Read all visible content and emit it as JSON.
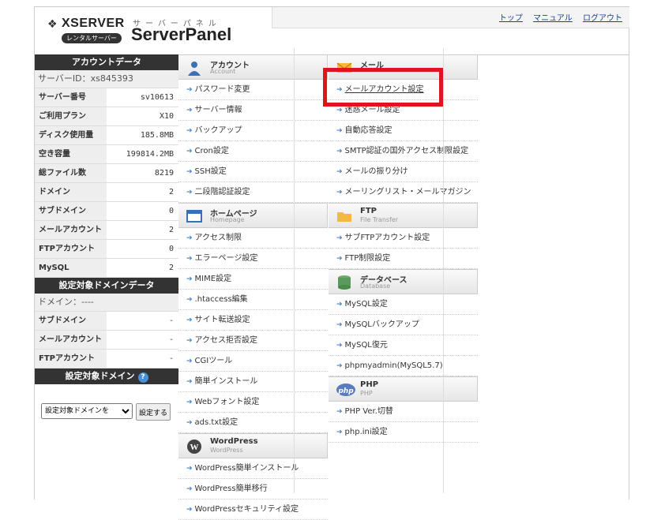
{
  "header": {
    "logo_text": "XSERVER",
    "logo_sub": "レンタルサーバー",
    "panel_kana": "サーバーパネル",
    "panel_title": "ServerPanel",
    "links": [
      "トップ",
      "マニュアル",
      "ログアウト"
    ]
  },
  "account": {
    "title": "アカウントデータ",
    "server_id_label": "サーバーID：",
    "server_id": "xs845393",
    "rows": [
      {
        "k": "サーバー番号",
        "v": "sv10613"
      },
      {
        "k": "ご利用プラン",
        "v": "X10"
      },
      {
        "k": "ディスク使用量",
        "v": "185.8MB"
      },
      {
        "k": "空き容量",
        "v": "199814.2MB"
      },
      {
        "k": "総ファイル数",
        "v": "8219"
      },
      {
        "k": "ドメイン",
        "v": "2"
      },
      {
        "k": "サブドメイン",
        "v": "0"
      },
      {
        "k": "メールアカウント",
        "v": "2"
      },
      {
        "k": "FTPアカウント",
        "v": "0"
      },
      {
        "k": "MySQL",
        "v": "2"
      }
    ]
  },
  "domain_data": {
    "title": "設定対象ドメインデータ",
    "domain_label": "ドメイン：",
    "domain_value": "----",
    "rows": [
      {
        "k": "サブドメイン",
        "v": "-"
      },
      {
        "k": "メールアカウント",
        "v": "-"
      },
      {
        "k": "FTPアカウント",
        "v": "-"
      }
    ]
  },
  "domain_select": {
    "title": "設定対象ドメイン",
    "select_value": "設定対象ドメインを",
    "button": "設定する"
  },
  "col1": {
    "account": {
      "title": "アカウント",
      "sub": "Account",
      "items": [
        "パスワード変更",
        "サーバー情報",
        "バックアップ",
        "Cron設定",
        "SSH設定",
        "二段階認証設定"
      ]
    },
    "homepage": {
      "title": "ホームページ",
      "sub": "Homepage",
      "items": [
        "アクセス制限",
        "エラーページ設定",
        "MIME設定",
        ".htaccess編集",
        "サイト転送設定",
        "アクセス拒否設定",
        "CGIツール",
        "簡単インストール",
        "Webフォント設定",
        "ads.txt設定"
      ]
    },
    "wordpress": {
      "title": "WordPress",
      "sub": "WordPress",
      "items": [
        "WordPress簡単インストール",
        "WordPress簡単移行",
        "WordPressセキュリティ設定"
      ]
    }
  },
  "col2": {
    "mail": {
      "title": "メール",
      "sub": "",
      "items": [
        "メールアカウント設定",
        "迷惑メール設定",
        "自動応答設定",
        "SMTP認証の国外アクセス制限設定",
        "メールの振り分け",
        "メーリングリスト・メールマガジン"
      ]
    },
    "ftp": {
      "title": "FTP",
      "sub": "File Transfer",
      "items": [
        "サブFTPアカウント設定",
        "FTP制限設定"
      ]
    },
    "database": {
      "title": "データベース",
      "sub": "Database",
      "items": [
        "MySQL設定",
        "MySQLバックアップ",
        "MySQL復元",
        "phpmyadmin(MySQL5.7)"
      ]
    },
    "php": {
      "title": "PHP",
      "sub": "PHP",
      "items": [
        "PHP Ver.切替",
        "php.ini設定"
      ]
    }
  },
  "colors": {
    "highlight": "#e0141c",
    "link": "#1a3fa0",
    "header_bg": "#333333"
  }
}
